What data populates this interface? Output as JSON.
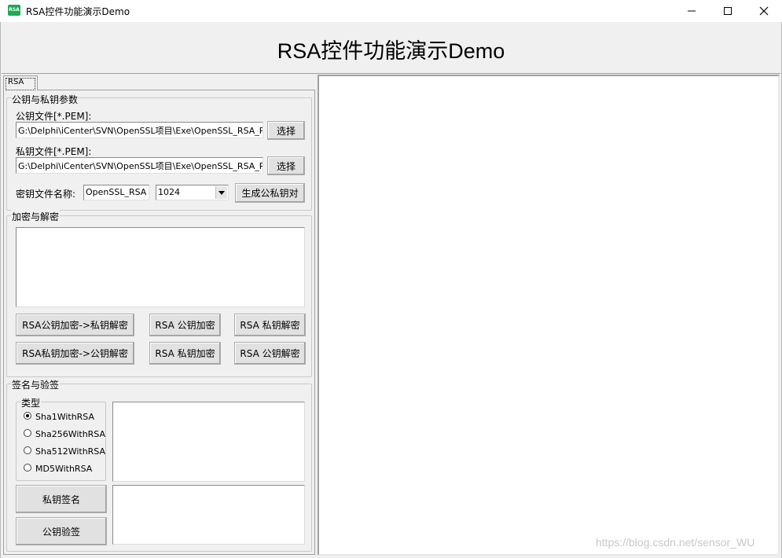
{
  "window": {
    "icon_text": "RSA",
    "title": "RSA控件功能演示Demo",
    "minimize_glyph": "—",
    "maximize_glyph": "☐",
    "close_glyph": "✕"
  },
  "header": {
    "title": "RSA控件功能演示Demo"
  },
  "tabs": [
    {
      "label": "RSA"
    }
  ],
  "keys_group": {
    "title": "公钥与私钥参数",
    "public_label": "公钥文件[*.PEM]:",
    "public_value": "G:\\Delphi\\iCenter\\SVN\\OpenSSL项目\\Exe\\OpenSSL_RSA_Public.pem",
    "public_browse": "选择",
    "private_label": "私钥文件[*.PEM]:",
    "private_value": "G:\\Delphi\\iCenter\\SVN\\OpenSSL项目\\Exe\\OpenSSL_RSA_Private.pem",
    "private_browse": "选择",
    "keyname_label": "密钥文件名称:",
    "keyname_value": "OpenSSL_RSA",
    "keysize_value": "1024",
    "generate_button": "生成公私钥对"
  },
  "crypt_group": {
    "title": "加密与解密",
    "buttons": {
      "pub_enc_priv_dec": "RSA公钥加密->私钥解密",
      "pub_encrypt": "RSA 公钥加密",
      "priv_decrypt": "RSA 私钥解密",
      "priv_enc_pub_dec": "RSA私钥加密->公钥解密",
      "priv_encrypt": "RSA 私钥加密",
      "pub_decrypt": "RSA 公钥解密"
    }
  },
  "sign_group": {
    "title": "签名与验签",
    "type_group_title": "类型",
    "options": [
      "Sha1WithRSA",
      "Sha256WithRSA",
      "Sha512WithRSA",
      "MD5WithRSA"
    ],
    "selected": "Sha1WithRSA",
    "sign_button": "私钥签名",
    "verify_button": "公钥验签"
  },
  "watermark": "https://blog.csdn.net/sensor_WU"
}
